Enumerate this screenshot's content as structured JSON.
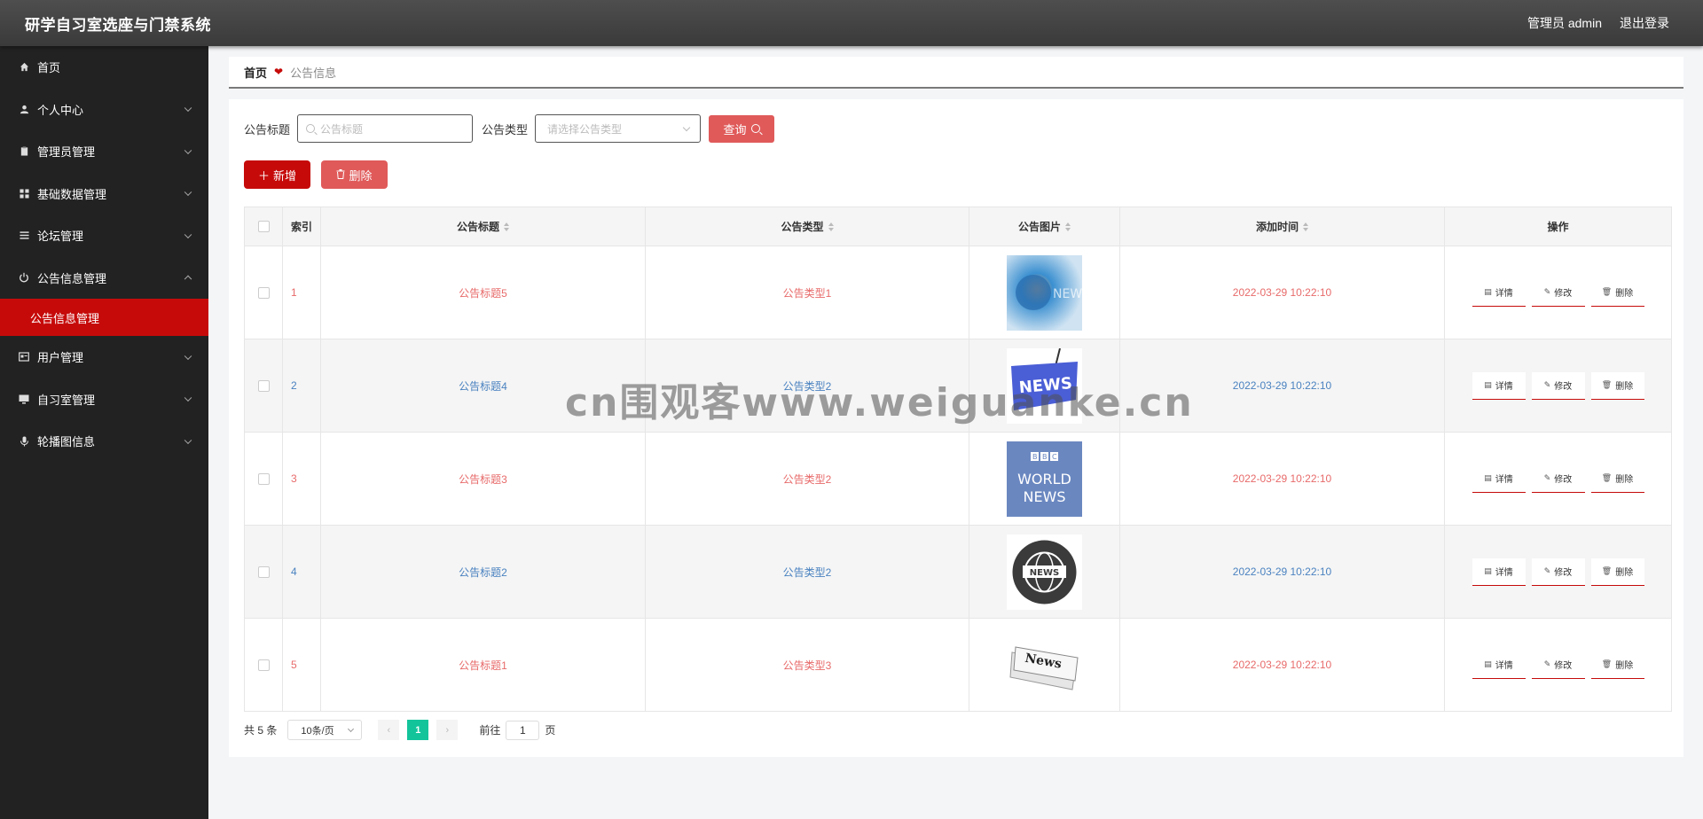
{
  "app": {
    "title": "研学自习室选座与门禁系统",
    "user_label": "管理员 admin",
    "logout_label": "退出登录"
  },
  "sidebar": {
    "items": [
      {
        "label": "首页",
        "icon": "home-icon"
      },
      {
        "label": "个人中心",
        "icon": "user-icon"
      },
      {
        "label": "管理员管理",
        "icon": "clipboard-icon"
      },
      {
        "label": "基础数据管理",
        "icon": "grid-icon"
      },
      {
        "label": "论坛管理",
        "icon": "list-icon"
      },
      {
        "label": "公告信息管理",
        "icon": "power-icon",
        "expanded": true
      },
      {
        "label": "用户管理",
        "icon": "card-icon"
      },
      {
        "label": "自习室管理",
        "icon": "monitor-icon"
      },
      {
        "label": "轮播图信息",
        "icon": "mic-icon"
      }
    ],
    "active_sub": "公告信息管理"
  },
  "breadcrumb": {
    "home": "首页",
    "current": "公告信息"
  },
  "search": {
    "title_label": "公告标题",
    "title_placeholder": "公告标题",
    "type_label": "公告类型",
    "type_placeholder": "请选择公告类型",
    "query_label": "查询"
  },
  "actions": {
    "add_label": "新增",
    "delete_label": "删除"
  },
  "table": {
    "headers": {
      "index": "索引",
      "title": "公告标题",
      "type": "公告类型",
      "image": "公告图片",
      "time": "添加时间",
      "ops": "操作"
    },
    "rows": [
      {
        "index": "1",
        "title": "公告标题5",
        "type": "公告类型1",
        "image": "news-globe-image",
        "time": "2022-03-29 10:22:10"
      },
      {
        "index": "2",
        "title": "公告标题4",
        "type": "公告类型2",
        "image": "news-blue-sign-image",
        "time": "2022-03-29 10:22:10"
      },
      {
        "index": "3",
        "title": "公告标题3",
        "type": "公告类型2",
        "image": "bbc-world-news-image",
        "time": "2022-03-29 10:22:10"
      },
      {
        "index": "4",
        "title": "公告标题2",
        "type": "公告类型2",
        "image": "news-globe-badge-image",
        "time": "2022-03-29 10:22:10"
      },
      {
        "index": "5",
        "title": "公告标题1",
        "type": "公告类型3",
        "image": "newspaper-image",
        "time": "2022-03-29 10:22:10"
      }
    ],
    "ops": {
      "detail": "详情",
      "edit": "修改",
      "delete": "删除"
    }
  },
  "pager": {
    "total": "共 5 条",
    "page_size": "10条/页",
    "current_page": "1",
    "goto_label": "前往",
    "goto_value": "1",
    "page_suffix": "页"
  },
  "watermark": "cn围观客www.weiguanke.cn",
  "colors": {
    "accent": "#c60a0a",
    "pager_active": "#13c49b",
    "row_red_text": "#e86a6a",
    "row_blue_text": "#4a82c0"
  }
}
